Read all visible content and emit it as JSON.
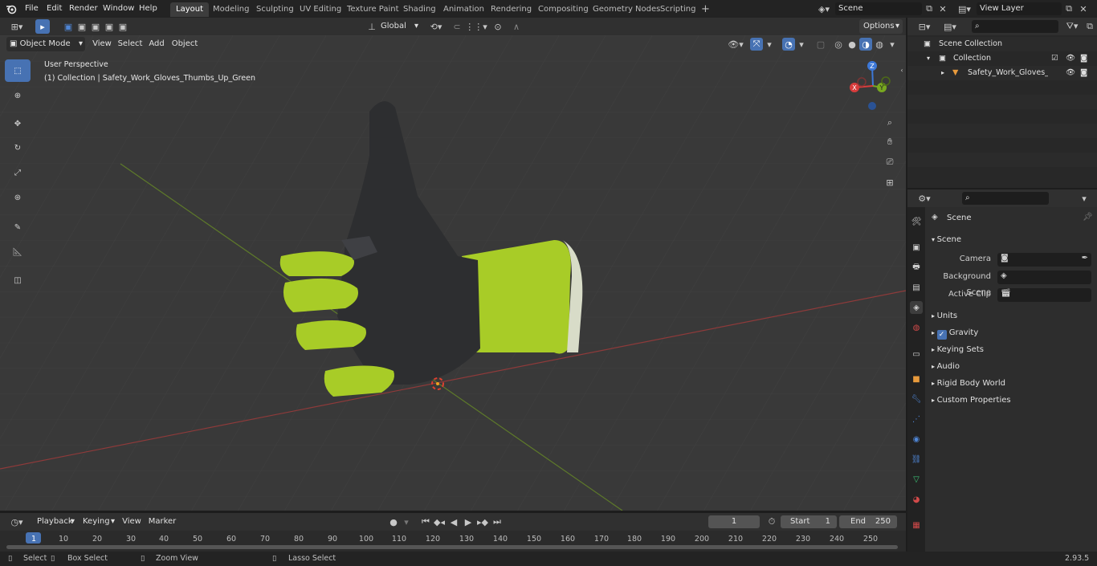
{
  "topbar": {
    "menus": [
      "File",
      "Edit",
      "Render",
      "Window",
      "Help"
    ],
    "workspaces": [
      "Layout",
      "Modeling",
      "Sculpting",
      "UV Editing",
      "Texture Paint",
      "Shading",
      "Animation",
      "Rendering",
      "Compositing",
      "Geometry Nodes",
      "Scripting"
    ],
    "active_workspace": "Layout",
    "add_tab": "+",
    "scene": "Scene",
    "view_layer": "View Layer"
  },
  "viewport_header": {
    "mode": "Object Mode",
    "menus": [
      "View",
      "Select",
      "Add",
      "Object"
    ],
    "transform_orientation": "Global",
    "options": "Options"
  },
  "viewport": {
    "perspective": "User Perspective",
    "collection_info": "(1) Collection | Safety_Work_Gloves_Thumbs_Up_Green",
    "gizmo": {
      "x": "X",
      "y": "Y",
      "z": "Z"
    }
  },
  "outliner": {
    "rows": [
      "Scene Collection",
      "Collection",
      "Safety_Work_Gloves_Thu"
    ]
  },
  "properties": {
    "context": "Scene",
    "panel": "Scene",
    "fields": [
      {
        "label": "Camera"
      },
      {
        "label": "Background Scene"
      },
      {
        "label": "Active Clip"
      }
    ],
    "sections": [
      "Units",
      "Gravity",
      "Keying Sets",
      "Audio",
      "Rigid Body World",
      "Custom Properties"
    ],
    "gravity_checked": true
  },
  "timeline": {
    "menus": [
      "Playback",
      "Keying",
      "View",
      "Marker"
    ],
    "current_frame": "1",
    "start_label": "Start",
    "start": "1",
    "end_label": "End",
    "end": "250",
    "ticks": [
      "1",
      "10",
      "20",
      "30",
      "40",
      "50",
      "60",
      "70",
      "80",
      "90",
      "100",
      "110",
      "120",
      "130",
      "140",
      "150",
      "160",
      "170",
      "180",
      "190",
      "200",
      "210",
      "220",
      "230",
      "240",
      "250"
    ]
  },
  "status": {
    "items": [
      "Select",
      "Box Select",
      "Zoom View",
      "Lasso Select"
    ],
    "version": "2.93.5"
  }
}
